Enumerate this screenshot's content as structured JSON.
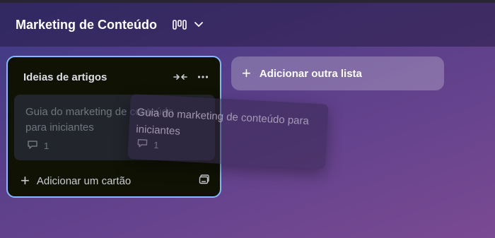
{
  "board": {
    "title": "Marketing de Conteúdo",
    "view_icon": "board-view-icon",
    "dropdown_icon": "chevron-down-icon"
  },
  "list": {
    "title": "Ideias de artigos",
    "collapse_icon": "collapse-icon",
    "menu_icon": "more-icon",
    "add_card_label": "Adicionar um cartão",
    "template_icon": "card-template-icon"
  },
  "card": {
    "title": "Guia do marketing de conteúdo para iniciantes",
    "comment_count": "1"
  },
  "dragged_card": {
    "title": "Guia do marketing de conteúdo para iniciantes",
    "comment_count": "1"
  },
  "add_list": {
    "label": "Adicionar outra lista"
  },
  "colors": {
    "accent_border": "#85b8ff",
    "list_bg": "#101204"
  }
}
